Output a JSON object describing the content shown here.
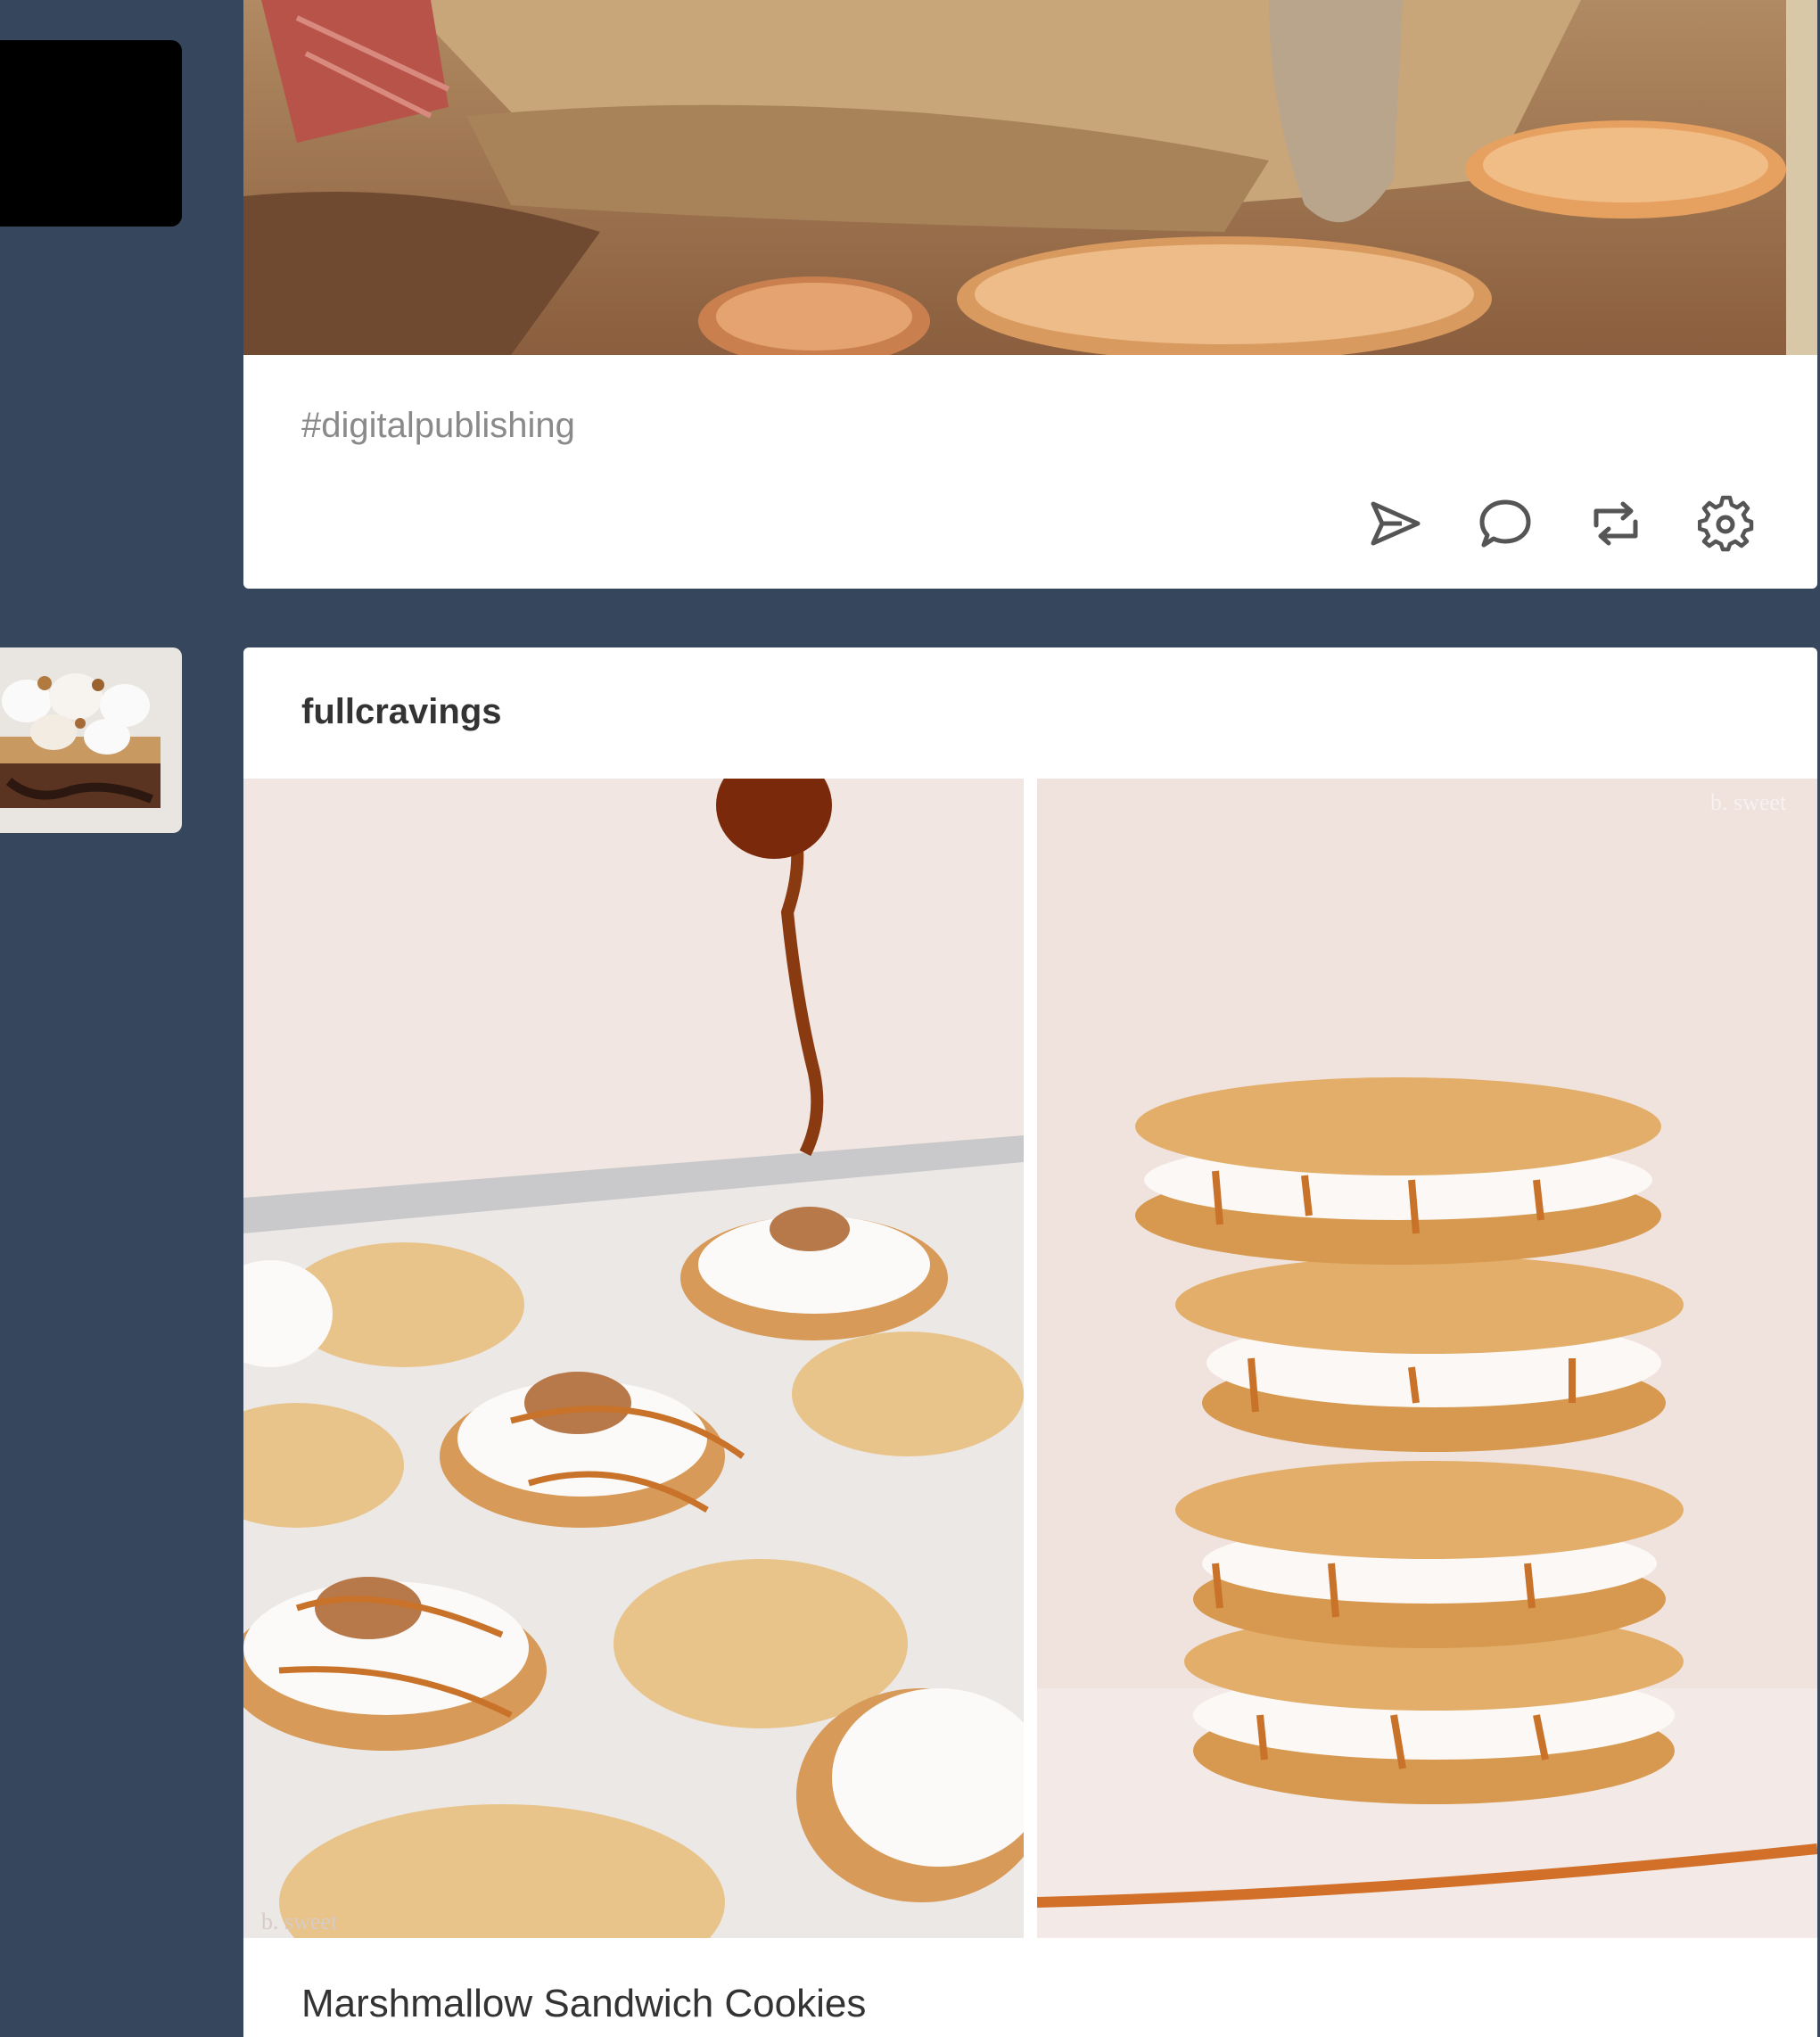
{
  "sidebar": {
    "avatars": [
      {
        "name": "avatar-black-square"
      },
      {
        "name": "avatar-smores-cake"
      }
    ]
  },
  "posts": [
    {
      "image_description": "close-up of baked pastry with orange slices and red whisk",
      "tags": "#digitalpublishing",
      "actions": [
        {
          "icon": "send-icon"
        },
        {
          "icon": "comment-icon"
        },
        {
          "icon": "reblog-icon"
        },
        {
          "icon": "settings-gear-icon"
        }
      ]
    },
    {
      "blog_name": "fullcravings",
      "photos": [
        {
          "watermark": "b. sweet"
        },
        {
          "watermark": "b. sweet"
        }
      ],
      "caption": "Marshmallow Sandwich Cookies"
    }
  ],
  "colors": {
    "dashboard_bg": "#36465d",
    "post_bg": "#ffffff",
    "icon_color": "#555555",
    "tag_color": "#8a8a8a"
  }
}
